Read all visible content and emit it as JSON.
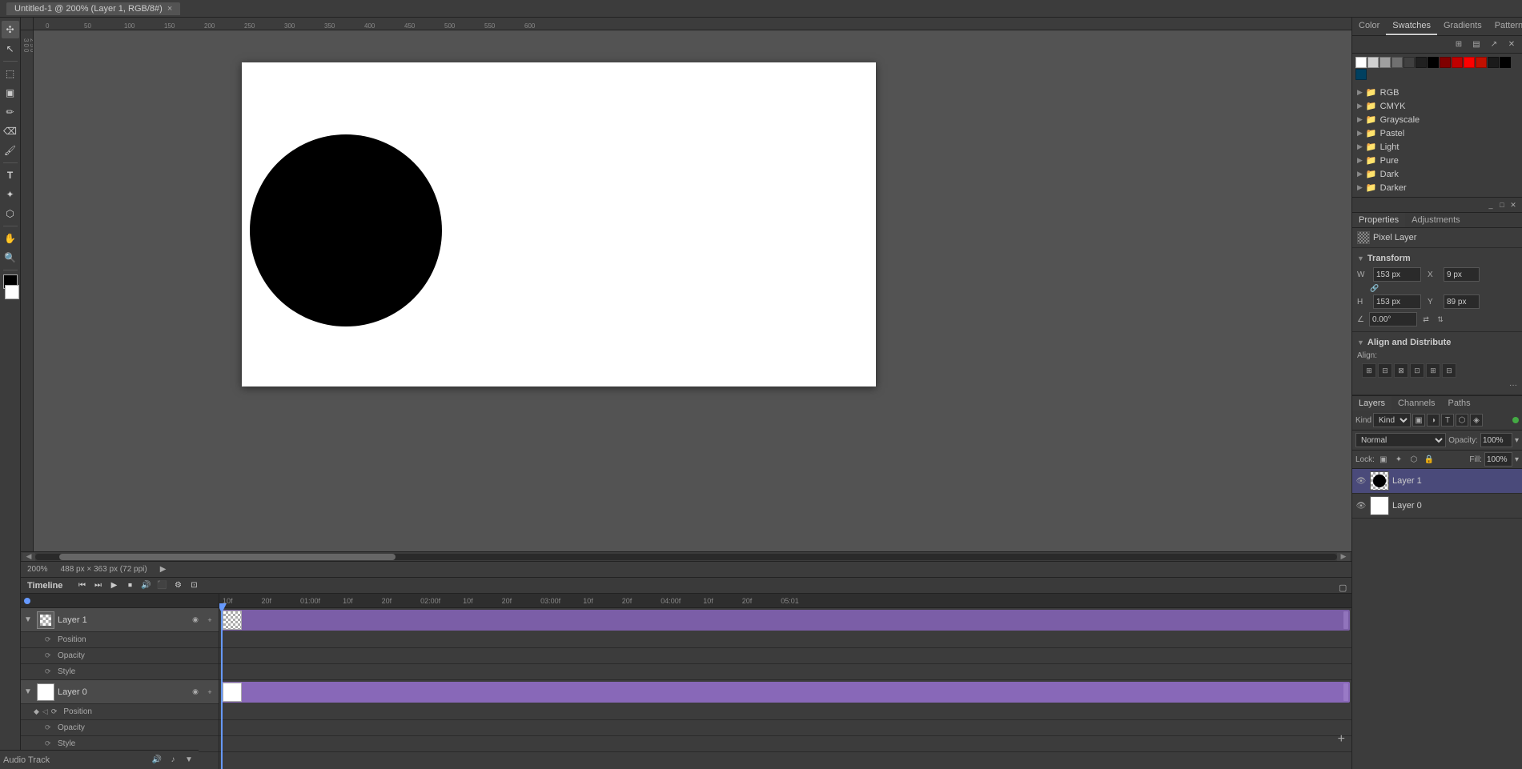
{
  "window": {
    "title": "Untitled-1 @ 200% (Layer 1, RGB/8#)",
    "tab_close": "×"
  },
  "toolbar_left": {
    "tools": [
      "✣",
      "↖",
      "⬚",
      "◻",
      "✏",
      "⌫",
      "🖌",
      "▣",
      "⚙",
      "T",
      "✦",
      "⬡",
      "✋",
      "🔍",
      "⬜",
      "☰"
    ]
  },
  "canvas": {
    "zoom": "200%",
    "dimensions": "488 px × 363 px (72 ppi)",
    "ruler_labels": [
      "0",
      "50",
      "100",
      "150",
      "200",
      "250",
      "300",
      "350",
      "400",
      "450",
      "500",
      "550",
      "600"
    ]
  },
  "timeline": {
    "title": "Timeline",
    "playback_btns": [
      "⏮",
      "⏭",
      "▶",
      "⏹",
      "🔊",
      "⬛"
    ],
    "time_markers": [
      "10f",
      "20f",
      "01:00f",
      "10f",
      "20f",
      "02:00f",
      "10f",
      "20f",
      "03:00f",
      "10f",
      "20f",
      "04:00f",
      "10f",
      "20f",
      "05:01"
    ],
    "layers": [
      {
        "name": "Layer 1",
        "expanded": true,
        "sub_layers": [
          "Position",
          "Opacity",
          "Style"
        ]
      },
      {
        "name": "Layer 0",
        "expanded": true,
        "sub_layers": [
          "Position",
          "Opacity",
          "Style"
        ]
      }
    ],
    "audio_track": "Audio Track"
  },
  "swatches_panel": {
    "tabs": [
      "Color",
      "Swatches",
      "Gradients",
      "Patterns"
    ],
    "active_tab": "Swatches",
    "color_row": [
      "#ffffff",
      "#d0d0d0",
      "#a0a0a0",
      "#707070",
      "#404040",
      "#202020",
      "#000000",
      "#800000",
      "#c00000",
      "#ff0000",
      "#ff8000",
      "#ffff00",
      "#008000",
      "#00ff00",
      "#0000ff",
      "#000080",
      "#800080",
      "#00ffff",
      "#004080"
    ],
    "groups": [
      "RGB",
      "CMYK",
      "Grayscale",
      "Pastel",
      "Light",
      "Pure",
      "Dark",
      "Darker"
    ]
  },
  "properties_panel": {
    "props_tab": "Properties",
    "adj_tab": "Adjustments",
    "active_props_tab": "Properties",
    "pixel_layer_label": "Pixel Layer",
    "transform": {
      "title": "Transform",
      "w_label": "W",
      "w_value": "153 px",
      "x_label": "X",
      "x_value": "9 px",
      "h_label": "H",
      "h_value": "153 px",
      "y_label": "Y",
      "y_value": "89 px",
      "angle_value": "0.00°"
    },
    "align": {
      "title": "Align and Distribute",
      "align_label": "Align:"
    }
  },
  "layers_panel": {
    "tabs": [
      "Layers",
      "Channels",
      "Paths"
    ],
    "active_tab": "Layers",
    "paths_tab": "Paths",
    "blend_mode": "Normal",
    "opacity_label": "Opacity:",
    "opacity_value": "100%",
    "lock_label": "Lock:",
    "fill_label": "Fill:",
    "fill_value": "100%",
    "layers": [
      {
        "name": "Layer 1",
        "visible": true,
        "selected": true,
        "has_circle": true
      },
      {
        "name": "Layer 0",
        "visible": true,
        "selected": false,
        "has_circle": false
      }
    ],
    "more_btn": "···"
  }
}
